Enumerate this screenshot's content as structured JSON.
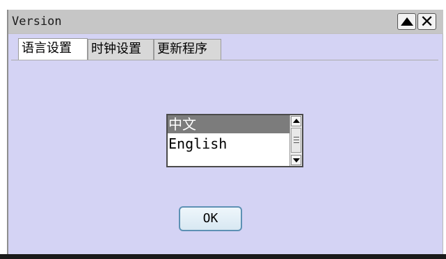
{
  "window": {
    "title": "Version",
    "controls": {
      "collapse_icon": "triangle-up-icon",
      "close_icon": "close-icon",
      "close_glyph": "✕"
    }
  },
  "tabs": [
    {
      "label": "语言设置",
      "active": true
    },
    {
      "label": "时钟设置",
      "active": false
    },
    {
      "label": "更新程序",
      "active": false
    }
  ],
  "language_list": {
    "items": [
      "中文",
      "English"
    ],
    "selected_index": 0
  },
  "ok_button": {
    "label": "OK"
  },
  "colors": {
    "panel_background": "#d4d3f4",
    "selection_background": "#7c7c7c",
    "button_border": "#5d91b4"
  }
}
